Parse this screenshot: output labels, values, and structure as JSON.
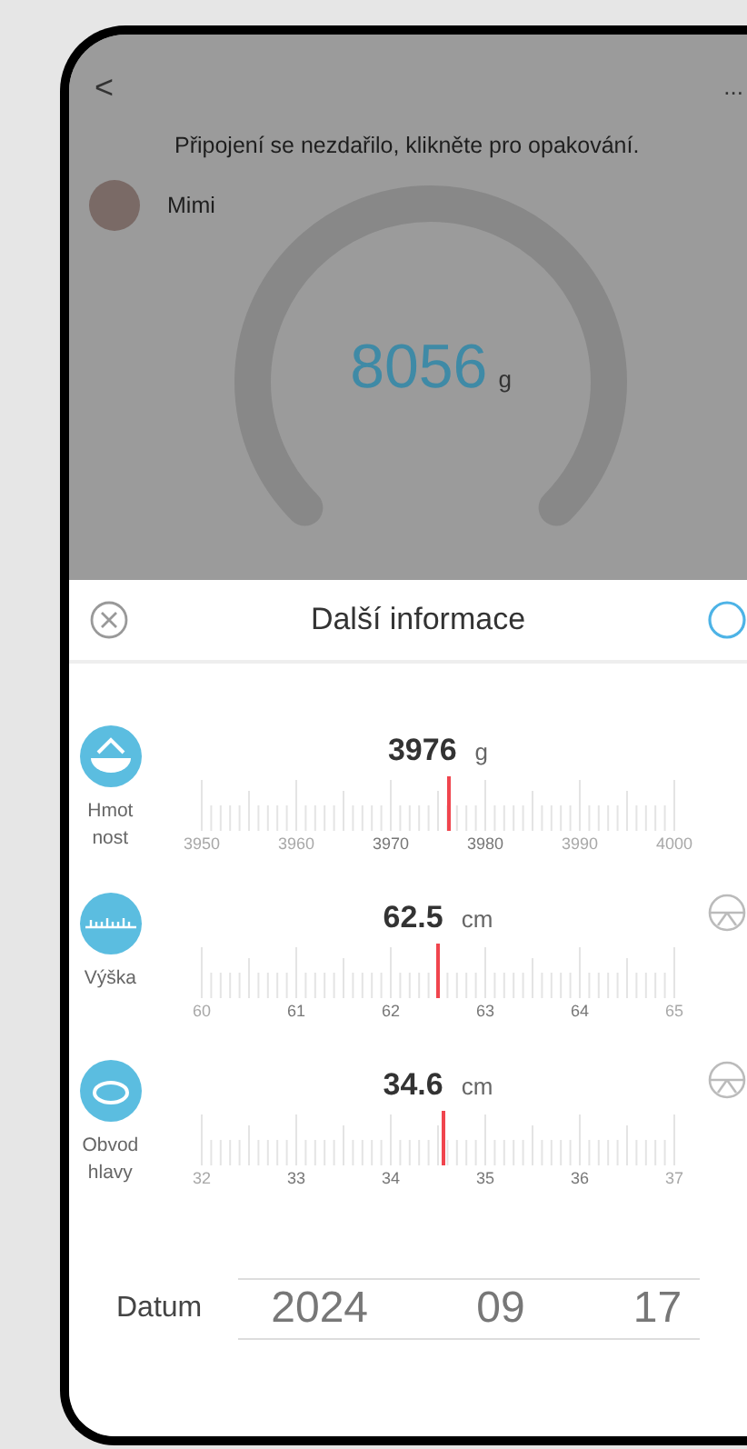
{
  "header": {
    "back": "<",
    "more": "..."
  },
  "connection_message": "Připojení se nezdařilo, klikněte pro opakování.",
  "profile": {
    "name": "Mimi"
  },
  "gauge": {
    "value": "8056",
    "unit": "g"
  },
  "sheet": {
    "title": "Další informace"
  },
  "measurements": [
    {
      "kind": "weight",
      "label": "Hmot nost",
      "value": "3976",
      "unit": "g",
      "level": 0.52,
      "ticks": [
        {
          "text": "3950",
          "faded": true
        },
        {
          "text": "3960",
          "faded": true
        },
        {
          "text": "3970",
          "faded": false
        },
        {
          "text": "3980",
          "faded": false
        },
        {
          "text": "3990",
          "faded": true
        },
        {
          "text": "4000",
          "faded": true
        }
      ]
    },
    {
      "kind": "height",
      "label": "Výška",
      "value": "62.5",
      "unit": "cm",
      "level": 0.5,
      "ticks": [
        {
          "text": "60",
          "faded": true
        },
        {
          "text": "61",
          "faded": false
        },
        {
          "text": "62",
          "faded": false
        },
        {
          "text": "63",
          "faded": false
        },
        {
          "text": "64",
          "faded": false
        },
        {
          "text": "65",
          "faded": true
        }
      ]
    },
    {
      "kind": "head",
      "label": "Obvod hlavy",
      "value": "34.6",
      "unit": "cm",
      "level": 0.51,
      "ticks": [
        {
          "text": "32",
          "faded": true
        },
        {
          "text": "33",
          "faded": false
        },
        {
          "text": "34",
          "faded": false
        },
        {
          "text": "35",
          "faded": false
        },
        {
          "text": "36",
          "faded": false
        },
        {
          "text": "37",
          "faded": true
        }
      ]
    }
  ],
  "date": {
    "label": "Datum",
    "year": "2024",
    "month": "09",
    "day": "17"
  }
}
